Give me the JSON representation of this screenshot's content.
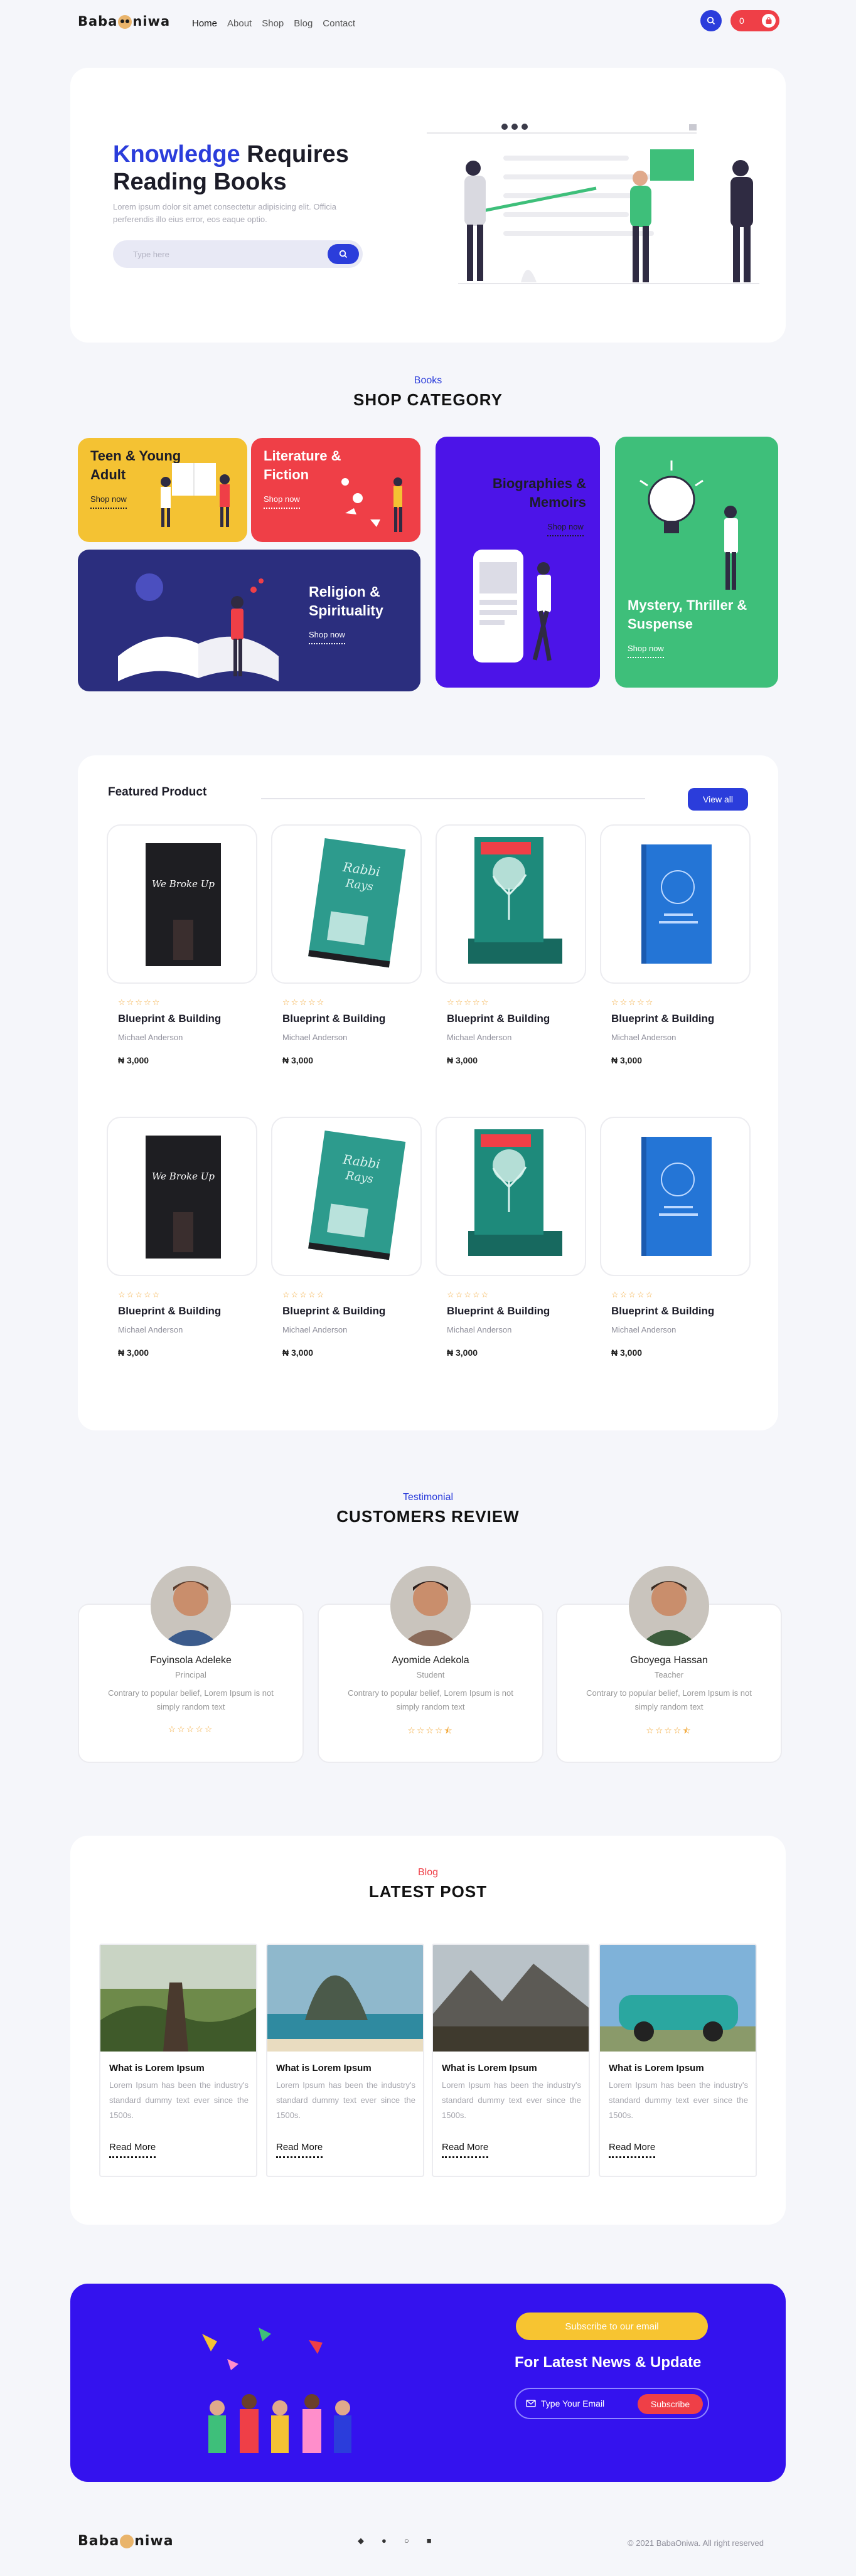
{
  "nav": {
    "logo_pre": "Baba",
    "logo_post": "niwa",
    "links": [
      "Home",
      "About",
      "Shop",
      "Blog",
      "Contact"
    ],
    "cart_count": "0"
  },
  "hero": {
    "title_accent": "Knowledge",
    "title_rest": " Requires",
    "title_line2": "Reading Books",
    "text": "Lorem ipsum dolor sit amet consectetur adipisicing elit. Officia perferendis illo eius error, eos eaque optio.",
    "search_placeholder": "Type here"
  },
  "categories": {
    "subtitle": "Books",
    "title": "SHOP CATEGORY",
    "shop_now": "Shop now",
    "items": [
      {
        "title": "Teen & Young Adult",
        "color": "#f4c233"
      },
      {
        "title": "Literature & Fiction",
        "color": "#ef3f47"
      },
      {
        "title": "Religion & Spirituality",
        "color": "#2b2e7e"
      },
      {
        "title": "Biographies & Memoirs",
        "color": "#4c14e8"
      },
      {
        "title": "Mystery, Thriller & Suspense",
        "color": "#3ebf7a"
      }
    ]
  },
  "featured": {
    "title": "Featured Product",
    "view_all": "View all",
    "products": [
      {
        "title": "Blueprint & Building",
        "author": "Michael Anderson",
        "price": "₦ 3,000",
        "cover": "We Broke Up"
      },
      {
        "title": "Blueprint & Building",
        "author": "Michael Anderson",
        "price": "₦ 3,000",
        "cover": "Rabbi Rays"
      },
      {
        "title": "Blueprint & Building",
        "author": "Michael Anderson",
        "price": "₦ 3,000",
        "cover": "Green"
      },
      {
        "title": "Blueprint & Building",
        "author": "Michael Anderson",
        "price": "₦ 3,000",
        "cover": "The Mastermind Blueprint"
      },
      {
        "title": "Blueprint & Building",
        "author": "Michael Anderson",
        "price": "₦ 3,000",
        "cover": "We Broke Up"
      },
      {
        "title": "Blueprint & Building",
        "author": "Michael Anderson",
        "price": "₦ 3,000",
        "cover": "Rabbi Rays"
      },
      {
        "title": "Blueprint & Building",
        "author": "Michael Anderson",
        "price": "₦ 3,000",
        "cover": "Green"
      },
      {
        "title": "Blueprint & Building",
        "author": "Michael Anderson",
        "price": "₦ 3,000",
        "cover": "The Mastermind Blueprint"
      }
    ]
  },
  "reviews": {
    "subtitle": "Testimonial",
    "title": "CUSTOMERS REVIEW",
    "items": [
      {
        "name": "Foyinsola Adeleke",
        "role": "Principal",
        "text": "Contrary to popular belief, Lorem Ipsum is not simply random text",
        "rating": 5
      },
      {
        "name": "Ayomide Adekola",
        "role": "Student",
        "text": "Contrary to popular belief, Lorem Ipsum is not simply random text",
        "rating": 4.5
      },
      {
        "name": "Gboyega Hassan",
        "role": "Teacher",
        "text": "Contrary to popular belief, Lorem Ipsum is not simply random text",
        "rating": 4.5
      }
    ]
  },
  "blog": {
    "subtitle": "Blog",
    "title": "LATEST POST",
    "posts": [
      {
        "title": "What is Lorem Ipsum",
        "text": "Lorem Ipsum has been the industry's standard dummy text ever since the 1500s.",
        "read_more": "Read More"
      },
      {
        "title": "What is Lorem Ipsum",
        "text": "Lorem Ipsum has been the industry's standard dummy text ever since the 1500s.",
        "read_more": "Read More"
      },
      {
        "title": "What is Lorem Ipsum",
        "text": "Lorem Ipsum has been the industry's standard dummy text ever since the 1500s.",
        "read_more": "Read More"
      },
      {
        "title": "What is Lorem Ipsum",
        "text": "Lorem Ipsum has been the industry's standard dummy text ever since the 1500s.",
        "read_more": "Read More"
      }
    ]
  },
  "newsletter": {
    "pill": "Subscribe to our email",
    "title": "For Latest News & Update",
    "email_placeholder": "Type Your Email",
    "button": "Subscribe"
  },
  "footer": {
    "logo_pre": "Baba",
    "logo_post": "niwa",
    "social_icons": [
      "twitter-icon",
      "facebook-icon",
      "instagram-icon",
      "linkedin-icon"
    ],
    "copyright": "© 2021 BabaOniwa. All right reserved"
  },
  "colors": {
    "primary": "#2b3ddb",
    "red": "#ef3f47",
    "yellow": "#f4c233",
    "purple": "#3412ee",
    "green": "#3ebf7a"
  }
}
